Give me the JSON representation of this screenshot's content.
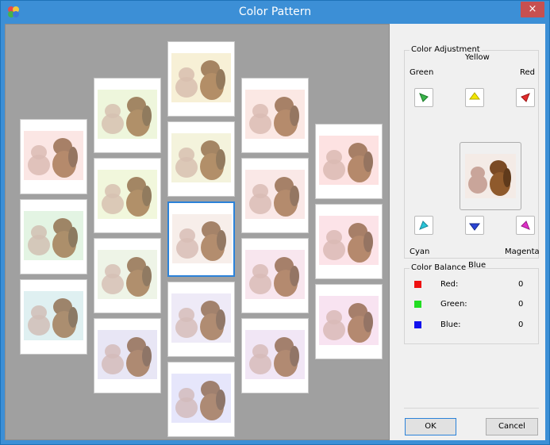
{
  "window": {
    "title": "Color Pattern",
    "close_label": "×"
  },
  "thumbnails": [
    {
      "col": 0,
      "row": 0,
      "tint": "#fbe6e4"
    },
    {
      "col": 0,
      "row": 1,
      "tint": "#e3f4e3"
    },
    {
      "col": 0,
      "row": 2,
      "tint": "#dff0f2"
    },
    {
      "col": 1,
      "row": 0,
      "tint": "#eef6dc"
    },
    {
      "col": 1,
      "row": 1,
      "tint": "#f2f7dc"
    },
    {
      "col": 1,
      "row": 2,
      "tint": "#eef4e7"
    },
    {
      "col": 1,
      "row": 3,
      "tint": "#e8e6f5"
    },
    {
      "col": 2,
      "row": 0,
      "tint": "#f7f0d6"
    },
    {
      "col": 2,
      "row": 1,
      "tint": "#f4f3dc"
    },
    {
      "col": 2,
      "row": 2,
      "tint": "#f7eeea",
      "selected": true
    },
    {
      "col": 2,
      "row": 3,
      "tint": "#eeeaf7"
    },
    {
      "col": 2,
      "row": 4,
      "tint": "#e6e6fb"
    },
    {
      "col": 3,
      "row": 0,
      "tint": "#fbe9e4"
    },
    {
      "col": 3,
      "row": 1,
      "tint": "#fae8e7"
    },
    {
      "col": 3,
      "row": 2,
      "tint": "#f8e6ee"
    },
    {
      "col": 3,
      "row": 3,
      "tint": "#f1e6f5"
    },
    {
      "col": 4,
      "row": 0,
      "tint": "#fde2e2"
    },
    {
      "col": 4,
      "row": 1,
      "tint": "#fce3e8"
    },
    {
      "col": 4,
      "row": 2,
      "tint": "#f8e3f1"
    }
  ],
  "color_adjustment": {
    "title": "Color Adjustment",
    "yellow": "Yellow",
    "green": "Green",
    "red": "Red",
    "cyan": "Cyan",
    "magenta": "Magenta",
    "blue": "Blue",
    "button_colors": {
      "green": "#3ab54a",
      "yellow": "#f2e600",
      "red": "#e32b2b",
      "cyan": "#29c4d8",
      "blue": "#2a45d6",
      "magenta": "#e02fc9"
    }
  },
  "color_balance": {
    "title": "Color Balance",
    "items": [
      {
        "label": "Red:",
        "value": "0",
        "color": "#ee1111"
      },
      {
        "label": "Green:",
        "value": "0",
        "color": "#22dd22"
      },
      {
        "label": "Blue:",
        "value": "0",
        "color": "#1111ee"
      }
    ]
  },
  "buttons": {
    "ok": "OK",
    "cancel": "Cancel"
  }
}
